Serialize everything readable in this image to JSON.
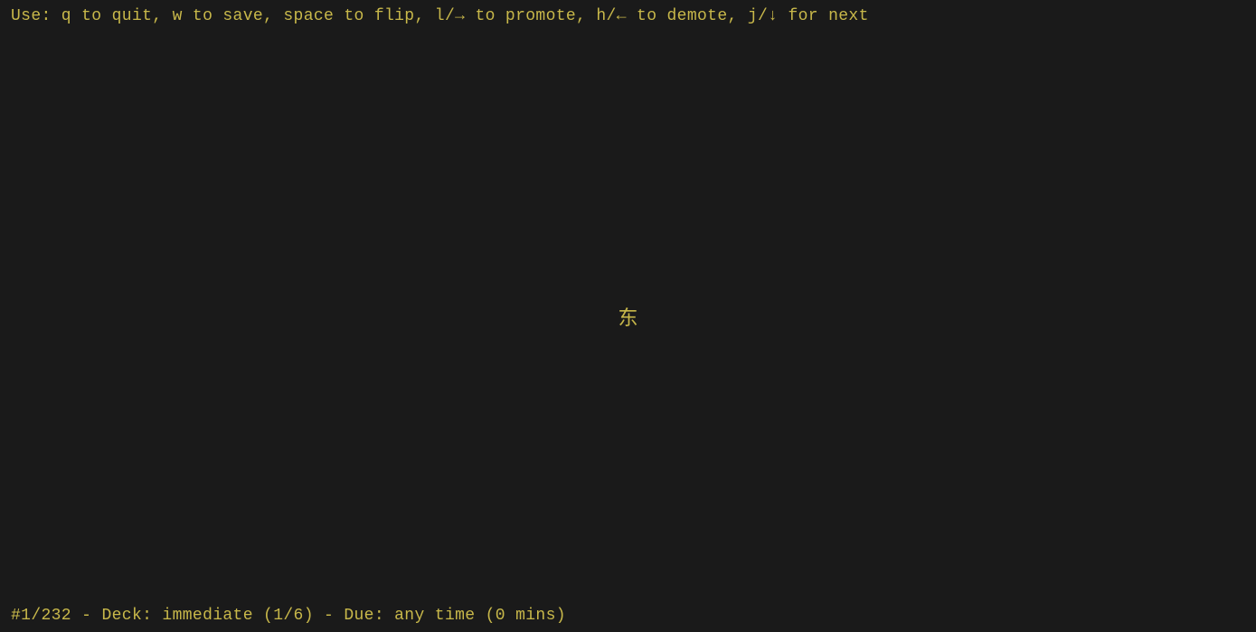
{
  "top_bar": {
    "instruction_text": "Use: q to quit, w to save, space to flip, l/→ to promote, h/← to demote, j/↓ for next"
  },
  "main": {
    "card_front": "东"
  },
  "bottom_bar": {
    "status_text": "#1/232 - Deck: immediate (1/6) - Due: any time (0 mins)"
  }
}
